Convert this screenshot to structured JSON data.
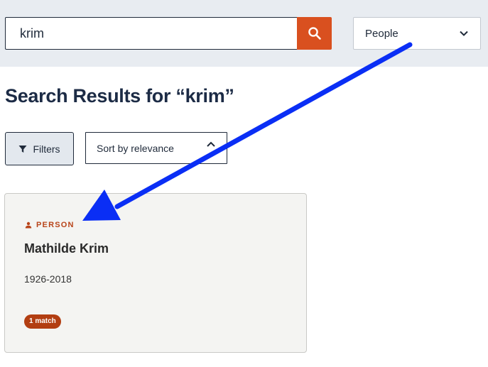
{
  "search": {
    "value": "krim"
  },
  "search_button": {
    "icon": "search-icon"
  },
  "scope": {
    "selected": "People",
    "icon": "chevron-down-icon"
  },
  "results": {
    "title": "Search Results for “krim”"
  },
  "toolbar": {
    "filters_label": "Filters",
    "filters_icon": "funnel-icon",
    "sort_selected": "Sort by relevance",
    "sort_icon": "sort-chevron-icon"
  },
  "cards": [
    {
      "type_label": "PERSON",
      "type_icon": "person-icon",
      "name": "Mathilde Krim",
      "dates": "1926-2018",
      "match_label": "1 match"
    }
  ],
  "colors": {
    "accent_orange": "#d9501f",
    "type_label_color": "#b8441a",
    "badge_color": "#b23e12",
    "header_bg": "#e8ecf1",
    "annotation_arrow": "#0a2ef5"
  }
}
